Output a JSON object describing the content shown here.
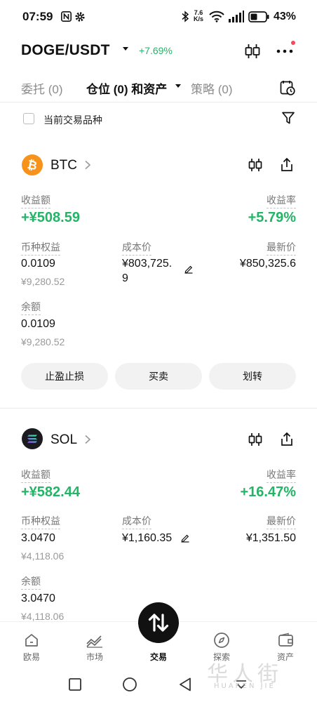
{
  "status_bar": {
    "time": "07:59",
    "net_speed_value": "7.6",
    "net_speed_unit": "K/s",
    "battery": "43%"
  },
  "header": {
    "pair": "DOGE/USDT",
    "change": "+7.69%"
  },
  "tabs": [
    {
      "label": "委托 (0)"
    },
    {
      "label": "仓位 (0) 和资产"
    },
    {
      "label": "策略 (0)"
    }
  ],
  "filter": {
    "checkbox_label": "当前交易品种"
  },
  "assets": [
    {
      "coin": "BTC",
      "pnl_label": "收益额",
      "pnl_value": "+¥508.59",
      "rate_label": "收益率",
      "rate_value": "+5.79%",
      "equity_label": "币种权益",
      "equity_value": "0.0109",
      "equity_fiat": "¥9,280.52",
      "cost_label": "成本价",
      "cost_value_line1": "¥803,725.",
      "cost_value_line2": "9",
      "last_label": "最新价",
      "last_value": "¥850,325.6",
      "balance_label": "余额",
      "balance_value": "0.0109",
      "balance_fiat": "¥9,280.52",
      "buttons": [
        "止盈止损",
        "买卖",
        "划转"
      ]
    },
    {
      "coin": "SOL",
      "pnl_label": "收益额",
      "pnl_value": "+¥582.44",
      "rate_label": "收益率",
      "rate_value": "+16.47%",
      "equity_label": "币种权益",
      "equity_value": "3.0470",
      "equity_fiat": "¥4,118.06",
      "cost_label": "成本价",
      "cost_value": "¥1,160.35",
      "last_label": "最新价",
      "last_value": "¥1,351.50",
      "balance_label": "余额",
      "balance_value": "3.0470",
      "balance_fiat": "¥4,118.06"
    }
  ],
  "bottom_nav": [
    {
      "label": "欧易",
      "icon": "home-icon"
    },
    {
      "label": "市场",
      "icon": "market-chart-icon"
    },
    {
      "label": "交易",
      "icon": "trade-swap-icon"
    },
    {
      "label": "探索",
      "icon": "compass-icon"
    },
    {
      "label": "资产",
      "icon": "wallet-icon"
    }
  ],
  "watermark": {
    "text": "华人街",
    "sub": "HUAREN JIE"
  },
  "colors": {
    "positive": "#25b467",
    "btc": "#f7931a",
    "sol": "#1b1b1f",
    "notification": "#ef4d5c"
  }
}
